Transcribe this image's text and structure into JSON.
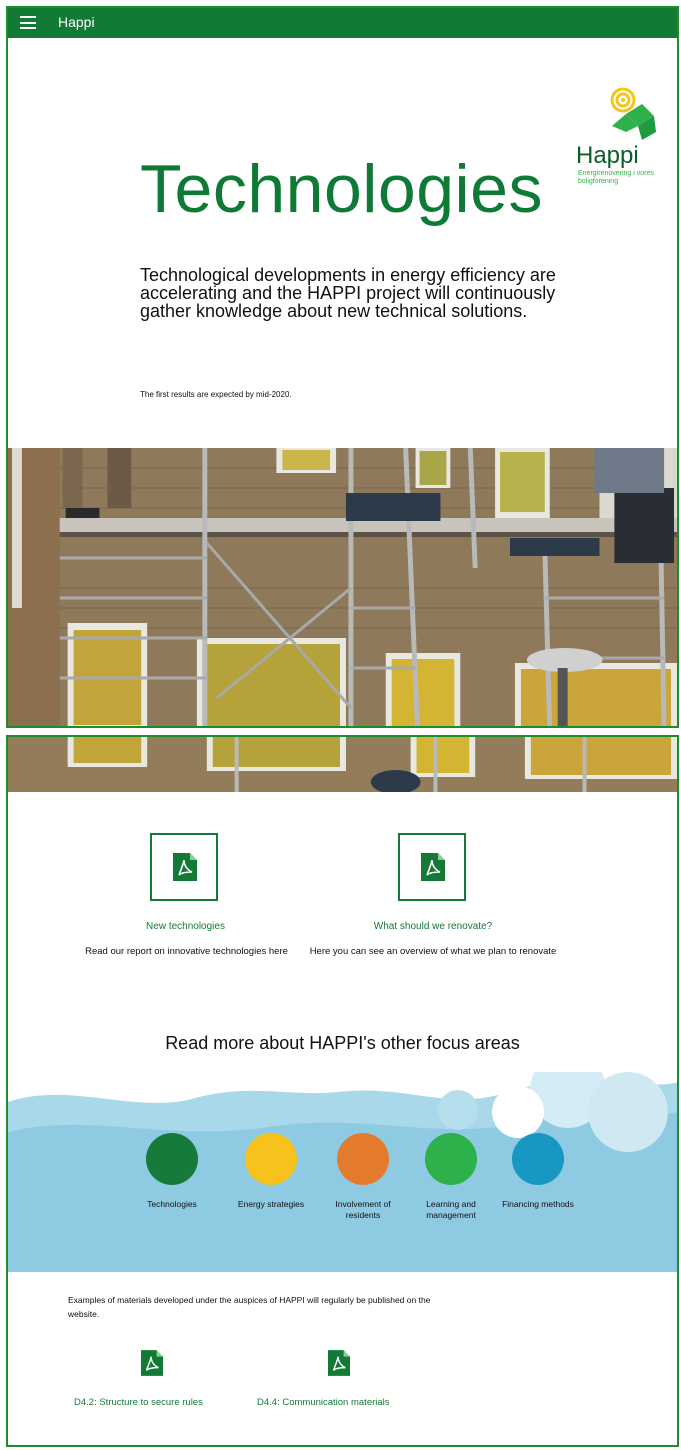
{
  "topbar": {
    "brand": "Happi",
    "menu_icon": "hamburger-menu-icon"
  },
  "logo": {
    "word": "Happi",
    "tagline": "Energirenovering i vores boligforening"
  },
  "hero": {
    "title": "Technologies",
    "lead": "Technological developments in energy efficiency are accelerating and the HAPPI project will continuously gather knowledge about new technical solutions.",
    "note": "The first results are expected by mid-2020."
  },
  "reports": [
    {
      "icon": "pdf-icon",
      "title": "New technologies",
      "description": "Read our report on innovative technologies here"
    },
    {
      "icon": "pdf-icon",
      "title": "What should we renovate?",
      "description": "Here you can see an overview of what we plan to renovate"
    }
  ],
  "focus": {
    "heading": "Read more about HAPPI's other focus areas",
    "areas": [
      {
        "label": "Technologies",
        "color": "#157a3a"
      },
      {
        "label": "Energy strategies",
        "color": "#f7c21c"
      },
      {
        "label": "Involvement of residents",
        "color": "#e47a2b"
      },
      {
        "label": "Learning and management",
        "color": "#2eb04a"
      },
      {
        "label": "Financing methods",
        "color": "#1797c2"
      }
    ]
  },
  "materials": {
    "intro": "Examples of materials developed under the auspices of HAPPI will regularly be published on the website.",
    "items": [
      {
        "icon": "pdf-icon",
        "label": "D4.2: Structure to secure rules"
      },
      {
        "icon": "pdf-icon",
        "label": "D4.4: Communication materials"
      }
    ]
  },
  "colors": {
    "brand_green": "#137a35",
    "title_green": "#0f7a36",
    "sky_blue": "#9fd3e6"
  }
}
